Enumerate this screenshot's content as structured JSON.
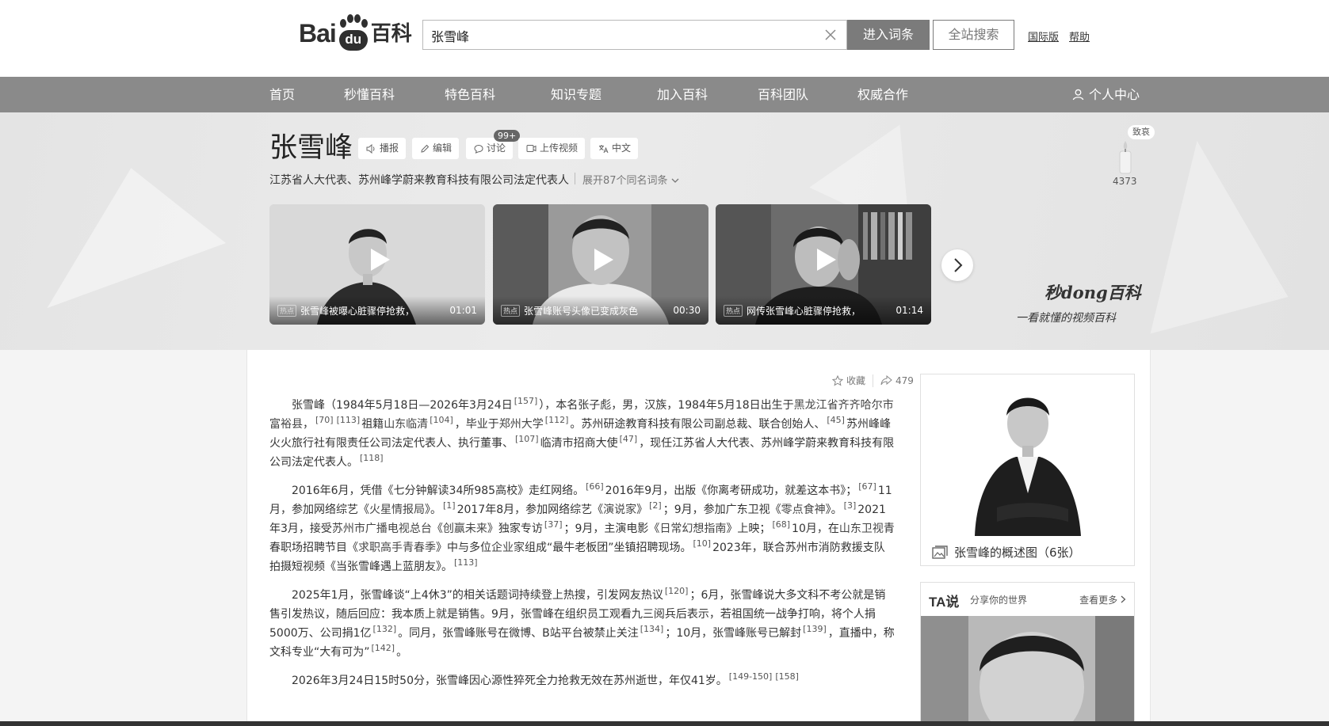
{
  "header": {
    "logo_bai": "Bai",
    "logo_du": "du",
    "logo_baike": "百科",
    "search_value": "张雪峰",
    "enter_button": "进入词条",
    "site_search_button": "全站搜索",
    "intl_link": "国际版",
    "help_link": "帮助"
  },
  "nav": {
    "items": [
      "首页",
      "秒懂百科",
      "特色百科",
      "知识专题",
      "加入百科",
      "百科团队",
      "权威合作"
    ],
    "user_center": "个人中心"
  },
  "entry": {
    "title": "张雪峰",
    "tools": {
      "report": "播报",
      "edit": "编辑",
      "discuss": "讨论",
      "discuss_badge": "99+",
      "upload_video": "上传视频",
      "language": "中文"
    },
    "subtitle": "江苏省人大代表、苏州峰学蔚来教育科技有限公司法定代表人",
    "expand": "展开87个同名词条",
    "tribute": "致哀",
    "candle_count": "4373"
  },
  "videos": [
    {
      "hot": "热点",
      "title": "张雪峰被曝心脏骤停抢救，",
      "duration": "01:01"
    },
    {
      "hot": "热点",
      "title": "张雪峰账号头像已变成灰色",
      "duration": "00:30"
    },
    {
      "hot": "热点",
      "title": "网传张雪峰心脏骤停抢救，",
      "duration": "01:14"
    }
  ],
  "miaodong": {
    "logo": "秒dong百科",
    "slogan": "一看就懂的视频百科"
  },
  "actions": {
    "collect": "收藏",
    "share_count": "479"
  },
  "summary": {
    "p1": {
      "t1": "张雪峰（1984年5月18日—2026年3月24日",
      "r1": "[157]",
      "t2": "），本名张子彪，男，汉族，1984年5月18日出生于",
      "l1": "黑龙江省齐齐哈尔市富裕县",
      "t3": "，",
      "r2": "[70]",
      "r3": "[113]",
      "t4": "祖籍",
      "l2": "山东临清",
      "r4": "[104]",
      "t5": "，毕业于",
      "l3": "郑州大学",
      "r5": "[112]",
      "t6": "。苏州研途教育科技有限公司副总裁、联合创始人、",
      "r6": "[45]",
      "t7": "苏州峰峰火火旅行社有限责任公司法定代表人、执行董事、",
      "r7": "[107]",
      "t8": "临清市招商大使",
      "r8": "[47]",
      "t9": "，现任江苏省人大代表、苏州峰学蔚来教育科技有限公司法定代表人。",
      "r9": "[118]"
    },
    "p2": {
      "t1": "2016年6月，凭借《七分钟解读34所985高校》走红网络。",
      "r1": "[66]",
      "t2": "2016年9月，出版《你离考研成功，就差这本书》；",
      "r2": "[67]",
      "t3": "11月，参加网络综艺《",
      "l1": "火星情报局",
      "t4": "》。",
      "r3": "[1]",
      "t5": "2017年8月，参加网络综艺《",
      "l2": "演说家",
      "t6": "》",
      "r4": "[2]",
      "t7": "；9月，参加广东卫视《",
      "l3": "零点食神",
      "t8": "》。",
      "r5": "[3]",
      "t9": "2021年3月，接受",
      "l4": "苏州市广播电视总台",
      "t10": "《",
      "l5": "创赢未来",
      "t11": "》独家专访",
      "r6": "[37]",
      "t12": "；9月，主演电影《",
      "l6": "日常幻想指南",
      "t13": "》上映；",
      "r7": "[68]",
      "t14": "10月，在",
      "l7": "山东卫视",
      "t15": "青春职场招聘节目《",
      "l8": "求职高手青春季",
      "t16": "》中与多位",
      "l9": "企业家",
      "t17": "组成“最牛老板团”坐镇招聘现场。",
      "r8": "[10]",
      "t18": "2023年，联合苏州市消防救援支队拍摄短视频《当张雪峰遇上蓝朋友》。",
      "r9": "[113]"
    },
    "p3": {
      "t1": "2025年1月，张雪峰谈“上4休3”的相关话题词持续登上热搜，引发网友热议",
      "r1": "[120]",
      "t2": "；6月，张雪峰说大多文科不考公就是销售引发热议，随后回应：我本质上就是销售。9月，张雪峰在组织员工观看九三阅兵后表示，若祖国统一战争打响，将个人捐5000万、公司捐1亿",
      "r2": "[132]",
      "t3": "。同月，张雪峰账号在微博、B站平台被禁止关注",
      "r3": "[134]",
      "t4": "；10月，张雪峰账号已解封",
      "r4": "[139]",
      "t5": "，直播中，称文科专业“大有可为”",
      "r5": "[142]",
      "t6": "。"
    },
    "p4": {
      "t1": "2026年3月24日15时50分，张雪峰因心源性猝死全力抢救无效在苏州逝世，年仅41岁。",
      "r1": "[149-150]",
      "r2": "[158]"
    }
  },
  "sidebar": {
    "album_caption": "张雪峰的概述图（6张）",
    "ta_logo": "TA说",
    "ta_sub": "分享你的世界",
    "ta_more": "查看更多"
  }
}
